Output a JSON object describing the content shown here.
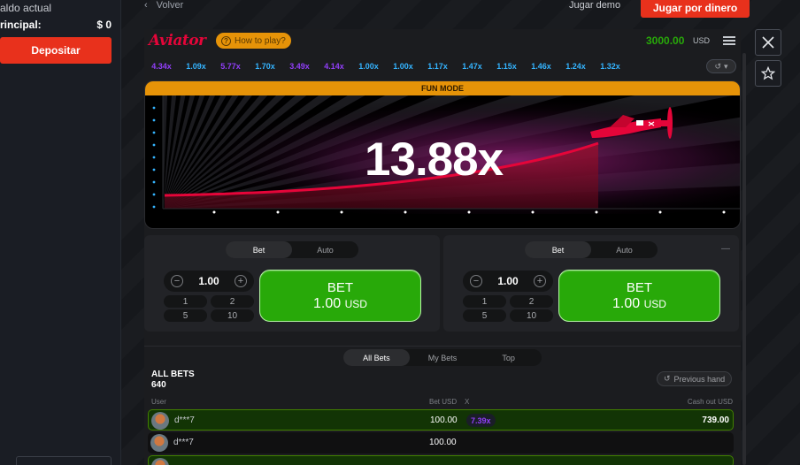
{
  "sidebar": {
    "saldo_label": "aldo actual",
    "principal_label": "rincipal:",
    "principal_value": "$ 0",
    "deposit_label": "Depositar"
  },
  "topbar": {
    "back_label": "Volver",
    "demo_label": "Jugar demo",
    "real_label": "Jugar por dinero"
  },
  "game": {
    "logo": "Aviator",
    "howto": "How to play?",
    "balance": "3000.00",
    "currency": "USD",
    "history": [
      {
        "v": "4.34x",
        "c": "#913ef8"
      },
      {
        "v": "1.09x",
        "c": "#34b4ff"
      },
      {
        "v": "5.77x",
        "c": "#913ef8"
      },
      {
        "v": "1.70x",
        "c": "#34b4ff"
      },
      {
        "v": "3.49x",
        "c": "#913ef8"
      },
      {
        "v": "4.14x",
        "c": "#913ef8"
      },
      {
        "v": "1.00x",
        "c": "#34b4ff"
      },
      {
        "v": "1.00x",
        "c": "#34b4ff"
      },
      {
        "v": "1.17x",
        "c": "#34b4ff"
      },
      {
        "v": "1.47x",
        "c": "#34b4ff"
      },
      {
        "v": "1.15x",
        "c": "#34b4ff"
      },
      {
        "v": "1.46x",
        "c": "#34b4ff"
      },
      {
        "v": "1.24x",
        "c": "#34b4ff"
      },
      {
        "v": "1.32x",
        "c": "#34b4ff"
      }
    ],
    "fun_mode": "FUN MODE",
    "multiplier": "13.88x"
  },
  "bet_panels": [
    {
      "tab_bet": "Bet",
      "tab_auto": "Auto",
      "stake": "1.00",
      "quick": [
        "1",
        "2",
        "5",
        "10"
      ],
      "btn_line1": "BET",
      "btn_amount": "1.00",
      "btn_cur": "USD"
    },
    {
      "tab_bet": "Bet",
      "tab_auto": "Auto",
      "stake": "1.00",
      "quick": [
        "1",
        "2",
        "5",
        "10"
      ],
      "btn_line1": "BET",
      "btn_amount": "1.00",
      "btn_cur": "USD"
    }
  ],
  "bets": {
    "tabs": [
      "All Bets",
      "My Bets",
      "Top"
    ],
    "title": "ALL BETS",
    "count": "640",
    "prev_hand": "Previous hand",
    "headers": {
      "user": "User",
      "bet": "Bet USD",
      "x": "X",
      "cash": "Cash out USD"
    },
    "rows": [
      {
        "user": "d***7",
        "bet": "100.00",
        "x": "7.39x",
        "cash": "739.00"
      },
      {
        "user": "d***7",
        "bet": "100.00",
        "x": "",
        "cash": ""
      }
    ]
  }
}
